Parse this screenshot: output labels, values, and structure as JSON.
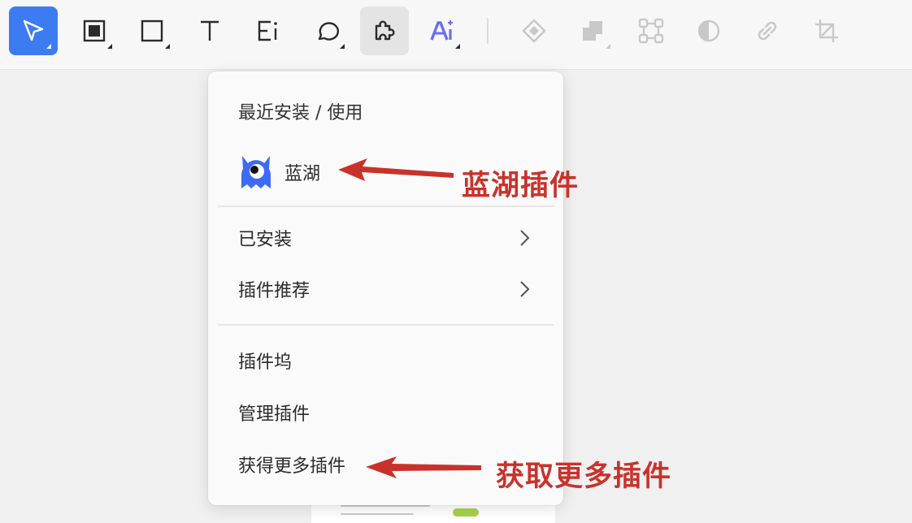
{
  "toolbar": {
    "tools": [
      {
        "icon": "select-arrow-icon",
        "state": "active"
      },
      {
        "icon": "frame-icon",
        "state": "normal"
      },
      {
        "icon": "rectangle-icon",
        "state": "normal"
      },
      {
        "icon": "text-icon",
        "state": "normal"
      },
      {
        "icon": "rich-text-icon",
        "state": "normal"
      },
      {
        "icon": "comment-icon",
        "state": "normal"
      },
      {
        "icon": "plugin-icon",
        "state": "hover"
      },
      {
        "icon": "ai-icon",
        "state": "normal"
      },
      {
        "icon": "component-icon",
        "state": "disabled"
      },
      {
        "icon": "boolean-icon",
        "state": "disabled"
      },
      {
        "icon": "transform-icon",
        "state": "disabled"
      },
      {
        "icon": "mask-icon",
        "state": "disabled"
      },
      {
        "icon": "link-icon",
        "state": "disabled"
      },
      {
        "icon": "crop-icon",
        "state": "disabled"
      }
    ],
    "colors": {
      "accent": "#3d7bf3",
      "ai": "#6b6ef5",
      "disabled": "#c8c8c8"
    }
  },
  "menu": {
    "recent_title": "最近安装 / 使用",
    "recent_plugin": {
      "name": "蓝湖",
      "icon": "lanhu-logo-icon",
      "color": "#3d6bf5"
    },
    "installed": "已安装",
    "recommended": "插件推荐",
    "plugin_hub": "插件坞",
    "manage": "管理插件",
    "get_more": "获得更多插件"
  },
  "annotations": {
    "lanhu_plugin": "蓝湖插件",
    "get_more_plugins": "获取更多插件",
    "color": "#c8322b"
  }
}
